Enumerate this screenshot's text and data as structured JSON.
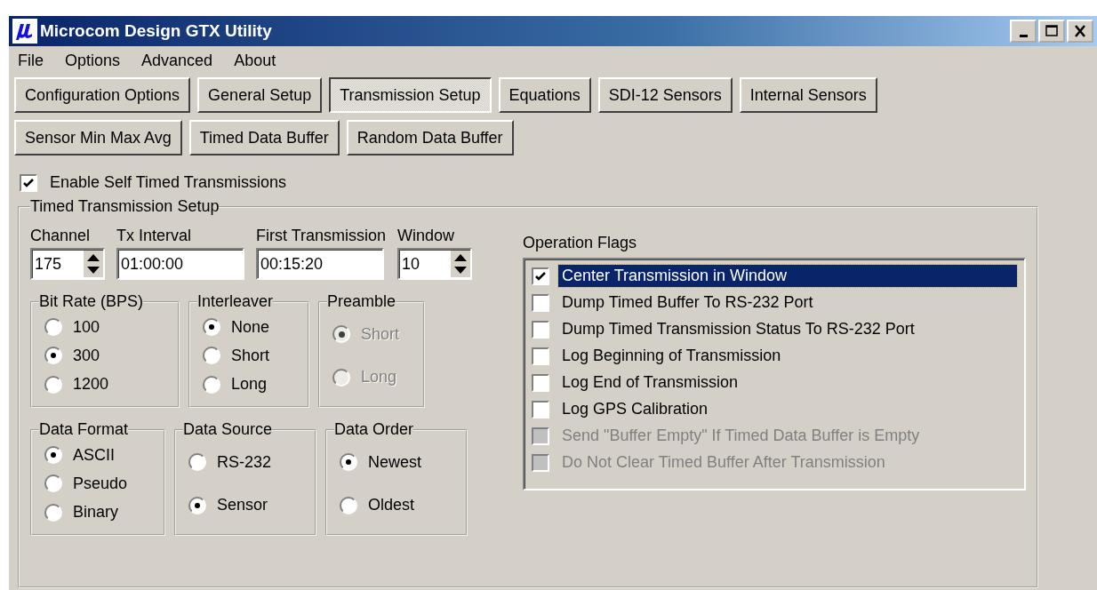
{
  "window": {
    "title": "Microcom Design GTX Utility"
  },
  "menu": [
    "File",
    "Options",
    "Advanced",
    "About"
  ],
  "tab_rows": [
    [
      {
        "label": "Configuration Options",
        "selected": false
      },
      {
        "label": "General Setup",
        "selected": false
      },
      {
        "label": "Transmission Setup",
        "selected": true
      },
      {
        "label": "Equations",
        "selected": false
      },
      {
        "label": "SDI-12 Sensors",
        "selected": false
      },
      {
        "label": "Internal Sensors",
        "selected": false
      }
    ],
    [
      {
        "label": "Sensor Min Max Avg",
        "selected": false
      },
      {
        "label": "Timed Data Buffer",
        "selected": false
      },
      {
        "label": "Random Data Buffer",
        "selected": false
      }
    ]
  ],
  "enable_checkbox": {
    "label": "Enable Self Timed Transmissions",
    "checked": true
  },
  "setup_group": {
    "title": "Timed Transmission Setup",
    "fields": [
      {
        "label": "Channel",
        "value": "175",
        "kind": "spinner"
      },
      {
        "label": "Tx Interval",
        "value": "01:00:00",
        "kind": "text"
      },
      {
        "label": "First Transmission",
        "value": "00:15:20",
        "kind": "text"
      },
      {
        "label": "Window",
        "value": "10",
        "kind": "spinner"
      }
    ],
    "radio_rows": [
      [
        {
          "title": "Bit Rate (BPS)",
          "disabled": false,
          "options": [
            {
              "label": "100",
              "selected": false
            },
            {
              "label": "300",
              "selected": true
            },
            {
              "label": "1200",
              "selected": false
            }
          ]
        },
        {
          "title": "Interleaver",
          "disabled": false,
          "options": [
            {
              "label": "None",
              "selected": true
            },
            {
              "label": "Short",
              "selected": false
            },
            {
              "label": "Long",
              "selected": false
            }
          ]
        },
        {
          "title": "Preamble",
          "disabled": true,
          "options": [
            {
              "label": "Short",
              "selected": true
            },
            {
              "label": "Long",
              "selected": false
            }
          ]
        }
      ],
      [
        {
          "title": "Data Format",
          "disabled": false,
          "options": [
            {
              "label": "ASCII",
              "selected": true
            },
            {
              "label": "Pseudo",
              "selected": false
            },
            {
              "label": "Binary",
              "selected": false
            }
          ]
        },
        {
          "title": "Data Source",
          "disabled": false,
          "options": [
            {
              "label": "RS-232",
              "selected": false
            },
            {
              "label": "Sensor",
              "selected": true
            }
          ]
        },
        {
          "title": "Data Order",
          "disabled": false,
          "options": [
            {
              "label": "Newest",
              "selected": true
            },
            {
              "label": "Oldest",
              "selected": false
            }
          ]
        }
      ]
    ],
    "operation_flags": {
      "title": "Operation Flags",
      "items": [
        {
          "label": "Center Transmission in Window",
          "checked": true,
          "disabled": false,
          "selected": true
        },
        {
          "label": "Dump Timed Buffer To RS-232 Port",
          "checked": false,
          "disabled": false,
          "selected": false
        },
        {
          "label": "Dump Timed Transmission Status To RS-232 Port",
          "checked": false,
          "disabled": false,
          "selected": false
        },
        {
          "label": "Log Beginning of Transmission",
          "checked": false,
          "disabled": false,
          "selected": false
        },
        {
          "label": "Log End of Transmission",
          "checked": false,
          "disabled": false,
          "selected": false
        },
        {
          "label": "Log GPS Calibration",
          "checked": false,
          "disabled": false,
          "selected": false
        },
        {
          "label": "Send \"Buffer Empty\" If Timed Data Buffer is Empty",
          "checked": false,
          "disabled": true,
          "selected": false
        },
        {
          "label": "Do Not Clear Timed Buffer After Transmission",
          "checked": false,
          "disabled": true,
          "selected": false
        }
      ]
    }
  }
}
